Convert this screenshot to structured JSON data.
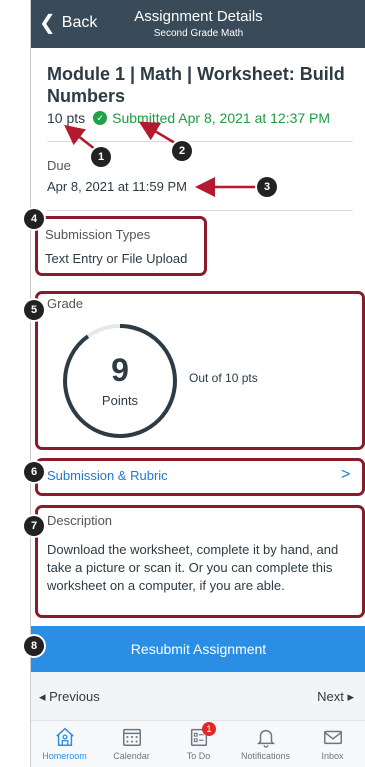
{
  "header": {
    "back_label": "Back",
    "title": "Assignment Details",
    "subtitle": "Second Grade Math"
  },
  "assignment": {
    "title": "Module 1 | Math | Worksheet: Build Numbers",
    "points": "10 pts",
    "submitted": "Submitted Apr 8, 2021 at 12:37 PM",
    "due_label": "Due",
    "due_value": "Apr 8, 2021 at 11:59 PM"
  },
  "submission_types": {
    "label": "Submission Types",
    "value": "Text Entry or File Upload"
  },
  "grade": {
    "label": "Grade",
    "score": "9",
    "unit": "Points",
    "out_of": "Out of 10 pts",
    "fraction": 0.9
  },
  "rubric": {
    "label": "Submission & Rubric",
    "chevron": ">"
  },
  "description": {
    "label": "Description",
    "text": "Download the worksheet, complete it by hand, and take a picture or scan it. Or you can complete this worksheet on a computer, if you are able."
  },
  "actions": {
    "resubmit": "Resubmit Assignment",
    "previous": "◂ Previous",
    "next": "Next ▸"
  },
  "tabs": [
    {
      "label": "Homeroom",
      "icon": "home-icon"
    },
    {
      "label": "Calendar",
      "icon": "calendar-icon"
    },
    {
      "label": "To Do",
      "icon": "todo-icon",
      "badge": "1"
    },
    {
      "label": "Notifications",
      "icon": "bell-icon"
    },
    {
      "label": "Inbox",
      "icon": "mail-icon"
    }
  ],
  "callouts": [
    "1",
    "2",
    "3",
    "4",
    "5",
    "6",
    "7",
    "8"
  ],
  "colors": {
    "header_bg": "#394b58",
    "accent": "#2a8ee5",
    "success": "#1e9d3e",
    "highlight_border": "#8b1a2b"
  }
}
